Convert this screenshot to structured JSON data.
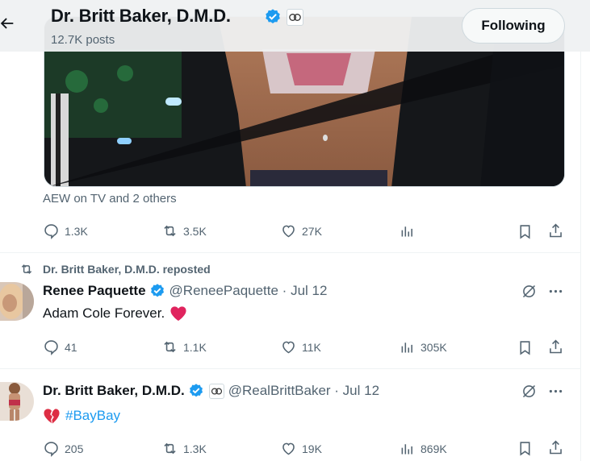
{
  "header": {
    "name": "Dr. Britt Baker, D.M.D.",
    "posts": "12.7K posts",
    "follow_button": "Following"
  },
  "tweet1": {
    "social_context": "AEW on TV and 2 others",
    "replies": "1.3K",
    "reposts": "3.5K",
    "likes": "27K"
  },
  "tweet2": {
    "repost_label": "Dr. Britt Baker, D.M.D. reposted",
    "name": "Renee Paquette",
    "handle_time": "@ReneePaquette · Jul 12",
    "text": "Adam Cole Forever.",
    "replies": "41",
    "reposts": "1.1K",
    "likes": "11K",
    "views": "305K"
  },
  "tweet3": {
    "name": "Dr. Britt Baker, D.M.D.",
    "handle_time": "@RealBrittBaker · Jul 12",
    "hashtag": "#BayBay",
    "replies": "205",
    "reposts": "1.3K",
    "likes": "19K",
    "views": "869K"
  },
  "colors": {
    "verified": "#1d9bf0",
    "muted": "#536471",
    "link": "#1d9bf0",
    "heart": "#e0245e"
  },
  "icons": [
    "back-arrow-icon",
    "verified-icon",
    "affiliate-badge-icon",
    "reply-icon",
    "repost-icon",
    "like-icon",
    "views-icon",
    "bookmark-icon",
    "share-icon",
    "grok-icon",
    "more-icon",
    "broken-heart-icon"
  ]
}
